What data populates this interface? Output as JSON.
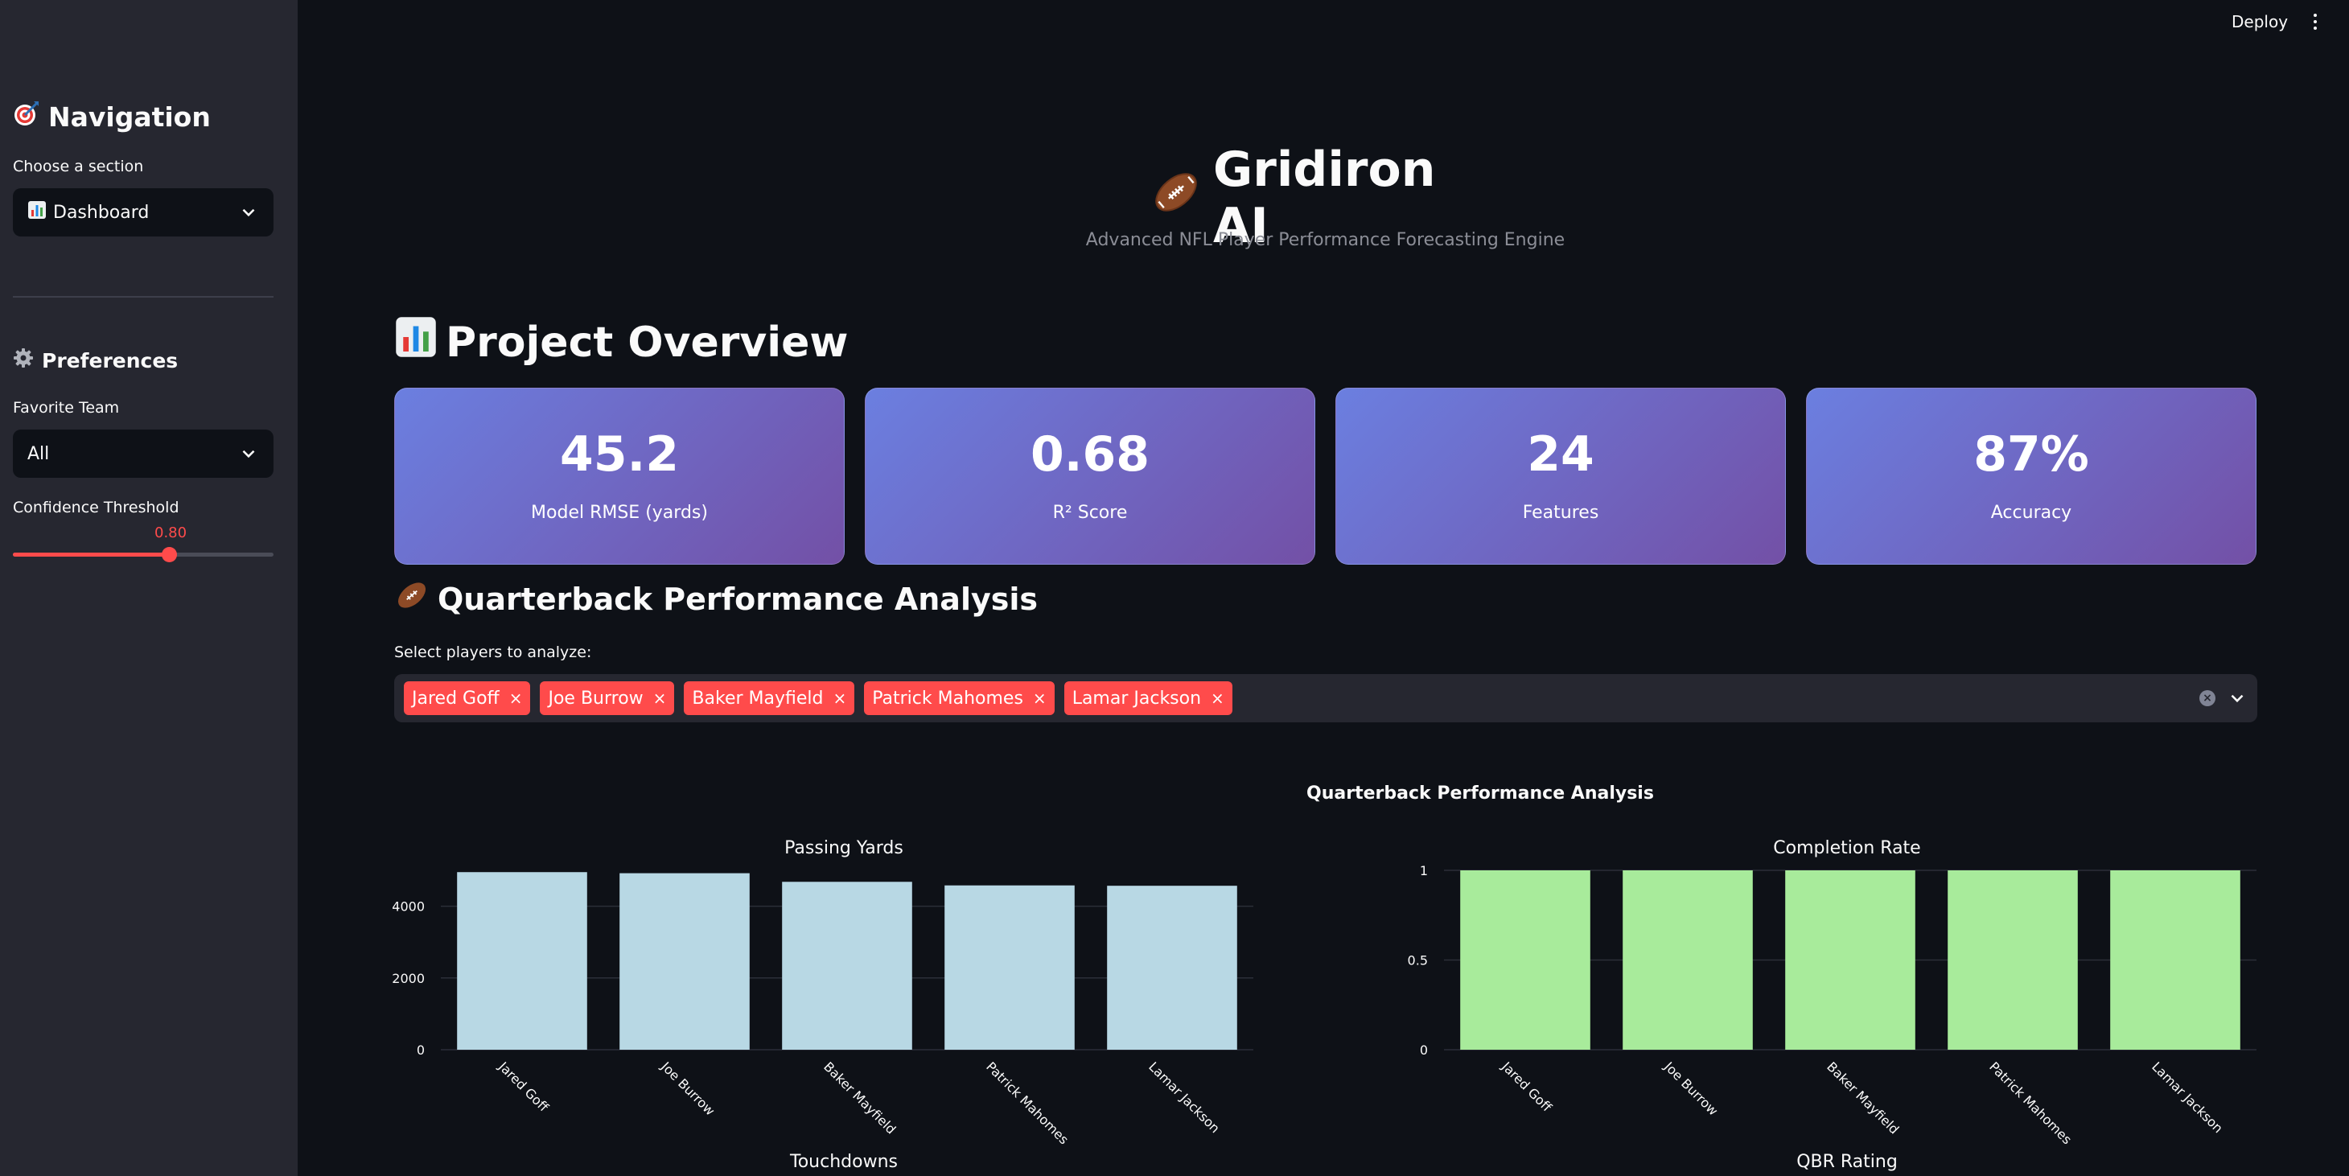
{
  "sidebar": {
    "nav_title": "Navigation",
    "nav_icon": "dart-target-icon",
    "section_label": "Choose a section",
    "section_select": {
      "value": "Dashboard",
      "icon": "bar-chart-icon"
    },
    "pref_title": "Preferences",
    "pref_icon": "gear-icon",
    "team_label": "Favorite Team",
    "team_select": {
      "value": "All"
    },
    "threshold_label": "Confidence Threshold",
    "threshold_value": "0.80",
    "threshold_fraction": 0.6
  },
  "topbar": {
    "deploy_label": "Deploy"
  },
  "header": {
    "title": "Gridiron AI",
    "subtitle": "Advanced NFL Player Performance Forecasting Engine"
  },
  "overview": {
    "title": "Project Overview",
    "metrics": [
      {
        "value": "45.2",
        "label": "Model RMSE (yards)"
      },
      {
        "value": "0.68",
        "label": "R² Score"
      },
      {
        "value": "24",
        "label": "Features"
      },
      {
        "value": "87%",
        "label": "Accuracy"
      }
    ]
  },
  "qb_section": {
    "title": "Quarterback Performance Analysis",
    "select_label": "Select players to analyze:",
    "selected_players": [
      "Jared Goff",
      "Joe Burrow",
      "Baker Mayfield",
      "Patrick Mahomes",
      "Lamar Jackson"
    ],
    "remove_glyph": "×"
  },
  "colors": {
    "accent": "#ff4b4b",
    "bar_blue": "#b8d8e4",
    "bar_green": "#a8eb9b"
  },
  "chart_data": [
    {
      "type": "bar",
      "title": "Passing Yards",
      "categories": [
        "Jared Goff",
        "Joe Burrow",
        "Baker Mayfield",
        "Patrick Mahomes",
        "Lamar Jackson"
      ],
      "values": [
        4950,
        4920,
        4680,
        4580,
        4570
      ],
      "ylim": [
        0,
        5000
      ],
      "yticks": [
        0,
        2000,
        4000
      ],
      "color": "#b8d8e4",
      "super_title": "Quarterback Performance Analysis"
    },
    {
      "type": "bar",
      "title": "Completion Rate",
      "categories": [
        "Jared Goff",
        "Joe Burrow",
        "Baker Mayfield",
        "Patrick Mahomes",
        "Lamar Jackson"
      ],
      "values": [
        1,
        1,
        1,
        1,
        1
      ],
      "ylim": [
        0,
        1
      ],
      "yticks": [
        0,
        0.5,
        1
      ],
      "color": "#a8eb9b"
    },
    {
      "type": "bar",
      "title": "Touchdowns",
      "categories": [],
      "values": []
    },
    {
      "type": "bar",
      "title": "QBR Rating",
      "categories": [],
      "values": []
    }
  ]
}
